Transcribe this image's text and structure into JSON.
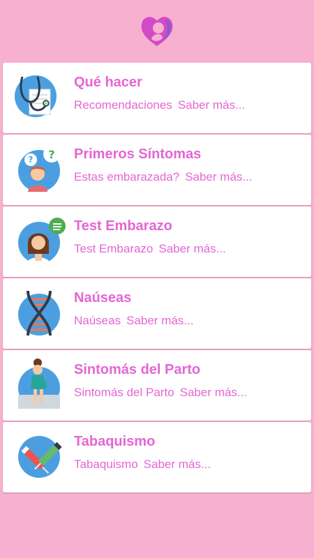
{
  "colors": {
    "background": "#f7b0cf",
    "accent": "#e466d4",
    "card": "#ffffff",
    "icon_circle": "#4b9fe0"
  },
  "header": {
    "logo_icon": "mother-baby-heart-icon"
  },
  "items": [
    {
      "title": "Qué hacer",
      "subtitle": "Recomendaciones",
      "more": "Saber más...",
      "icon": "stethoscope-icon"
    },
    {
      "title": "Primeros Síntomas",
      "subtitle": "Estas embarazada?",
      "more": "Saber más...",
      "icon": "question-woman-icon"
    },
    {
      "title": "Test Embarazo",
      "subtitle": "Test Embarazo",
      "more": "Saber más...",
      "icon": "woman-chat-icon"
    },
    {
      "title": "Naúseas",
      "subtitle": "Naúseas",
      "more": "Saber más...",
      "icon": "dna-icon"
    },
    {
      "title": "Sintomás del Parto",
      "subtitle": "Sintomás del Parto",
      "more": "Saber más...",
      "icon": "pregnant-woman-icon"
    },
    {
      "title": "Tabaquismo",
      "subtitle": "Tabaquismo",
      "more": "Saber más...",
      "icon": "syringe-icon"
    }
  ]
}
